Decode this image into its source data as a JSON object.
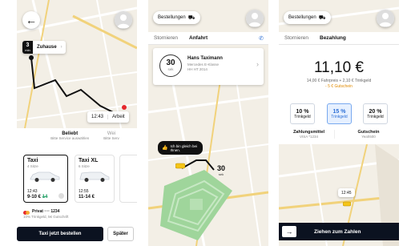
{
  "screen1": {
    "eta_minutes": "3",
    "eta_unit": "min",
    "destination_label": "Zuhause",
    "time_label": "12:43",
    "arrival_label": "Arbeit",
    "tabs": [
      {
        "title": "Beliebt",
        "subtitle": "Bitte Service auswählen"
      },
      {
        "title": "Wei",
        "subtitle": "Bitte Serv"
      }
    ],
    "options": [
      {
        "name": "Taxi",
        "seats": "4 Sitze",
        "time": "12:43",
        "price": "9-10 €",
        "old_price": "14"
      },
      {
        "name": "Taxi XL",
        "seats": "6 Sitze",
        "time": "12:55",
        "price": "11-14 €"
      }
    ],
    "payment": {
      "line1": "Privat ···· 1234",
      "line2": "10% Trinkgeld, 5€ Gutschrift"
    },
    "order_button": "Taxi jetzt bestellen",
    "later_button": "Später"
  },
  "screen2": {
    "orders_button": "Bestellungen",
    "tab_cancel": "Stornieren",
    "tab_approach": "Anfahrt",
    "eta_value": "30",
    "eta_unit": "sek",
    "driver_name": "Hans Taximann",
    "car_model": "Mercedes E-Klasse",
    "plate": "HH HT 2014",
    "bubble_text": "Ich bin gleich bei Ihnen.",
    "map_eta_value": "30",
    "map_eta_unit": "sek"
  },
  "screen3": {
    "orders_button": "Bestellungen",
    "tab_cancel": "Stornieren",
    "tab_pay": "Bezahlung",
    "amount": "11,10 €",
    "breakdown": "14,00 € Fahrpreis + 2,10 € Trinkgeld",
    "voucher_line": "- 5 € Gutschein",
    "tips": [
      {
        "pct": "10 %",
        "label": "Trinkgeld"
      },
      {
        "pct": "15 %",
        "label": "Trinkgeld"
      },
      {
        "pct": "20 %",
        "label": "Trinkgeld"
      }
    ],
    "payment_method_label": "Zahlungsmittel",
    "payment_method_value": "VISA *1234",
    "voucher_label": "Gutschein",
    "voucher_value": "Yeah500",
    "map_time": "12:45",
    "swipe_label": "Ziehen zum Zahlen"
  },
  "colors": {
    "accent": "#2c6fd6",
    "dark": "#0b1220",
    "taxi": "#f5c518",
    "park": "#9fd59b",
    "discount": "#2aa36b",
    "voucher_text": "#e08a00",
    "pay_card": "#f5a623"
  },
  "icons": {
    "back": "arrow-left-icon",
    "avatar": "user-avatar-icon",
    "phone": "phone-icon",
    "chevron": "chevron-right-icon",
    "thumb": "thumbs-up-icon",
    "taxi": "taxi-icon",
    "arrow": "arrow-right-icon"
  }
}
